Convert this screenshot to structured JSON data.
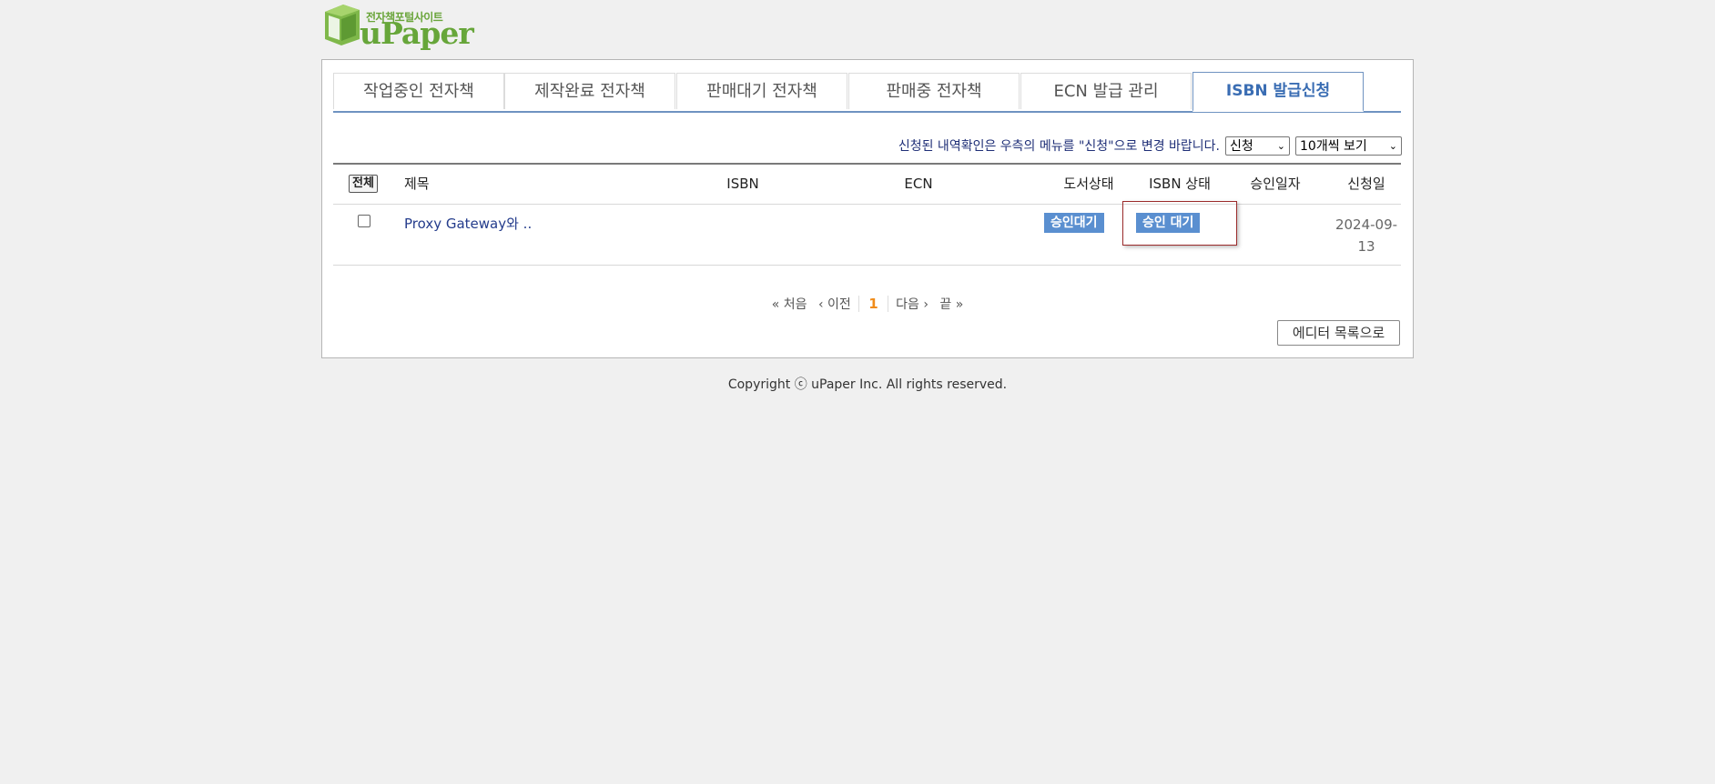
{
  "logo": {
    "sub_text": "전자책포털사이트",
    "main_text": "uPaper"
  },
  "tabs": [
    {
      "label": "작업중인 전자책"
    },
    {
      "label": "제작완료 전자책"
    },
    {
      "label": "판매대기 전자책"
    },
    {
      "label": "판매중 전자책"
    },
    {
      "label": "ECN 발급 관리"
    },
    {
      "label": "ISBN 발급신청",
      "active": true
    }
  ],
  "notice": {
    "text": "신청된 내역확인은 우측의 메뉴를 \"신청\"으로 변경 바랍니다.",
    "status_select": "신청",
    "page_size_select": "10개씩 보기"
  },
  "table": {
    "headers": {
      "select_all": "전체",
      "title": "제목",
      "isbn": "ISBN",
      "ecn": "ECN",
      "book_status": "도서상태",
      "isbn_status": "ISBN 상태",
      "approval_date": "승인일자",
      "request_date": "신청일"
    },
    "rows": [
      {
        "title": "Proxy Gateway와 ..",
        "isbn": "",
        "ecn": "",
        "book_status": "승인대기",
        "isbn_status": "승인 대기",
        "approval_date": "",
        "request_date_line1": "2024-09-",
        "request_date_line2": "13"
      }
    ]
  },
  "pager": {
    "first": "« 처음",
    "prev": "‹ 이전",
    "current": "1",
    "next": "다음 ›",
    "last": "끝 »"
  },
  "editor_button": "에디터 목록으로",
  "footer": "Copyright ⓒ uPaper Inc. All rights reserved."
}
